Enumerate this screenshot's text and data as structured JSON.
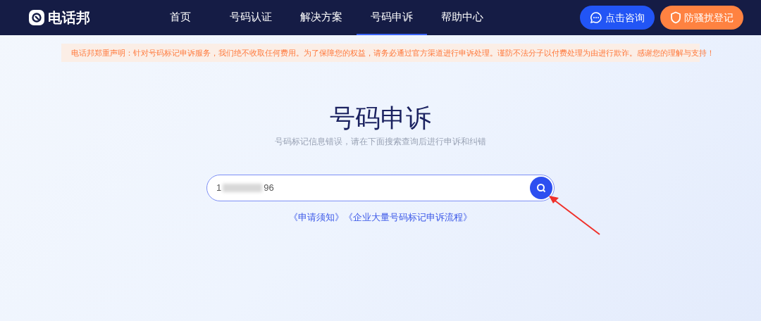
{
  "header": {
    "logo_text": "电话邦",
    "nav": [
      {
        "label": "首页",
        "selected": false
      },
      {
        "label": "号码认证",
        "selected": false
      },
      {
        "label": "解决方案",
        "selected": false
      },
      {
        "label": "号码申诉",
        "selected": true
      },
      {
        "label": "帮助中心",
        "selected": false
      }
    ],
    "buttons": [
      {
        "label": "点击咨询",
        "kind": "consult"
      },
      {
        "label": "防骚扰登记",
        "kind": "register"
      }
    ]
  },
  "notice": "电话邦郑重声明：针对号码标记申诉服务，我们绝不收取任何费用。为了保障您的权益，请务必通过官方渠道进行申诉处理。谨防不法分子以付费处理为由进行欺诈。感谢您的理解与支持！",
  "title": "号码申诉",
  "subtitle": "号码标记信息错误，请在下面搜索查询后进行申诉和纠错",
  "search": {
    "value_start": "1",
    "value_end": "96",
    "redacted": true
  },
  "links": [
    "《申请须知》",
    "《企业大量号码标记申诉流程》"
  ]
}
